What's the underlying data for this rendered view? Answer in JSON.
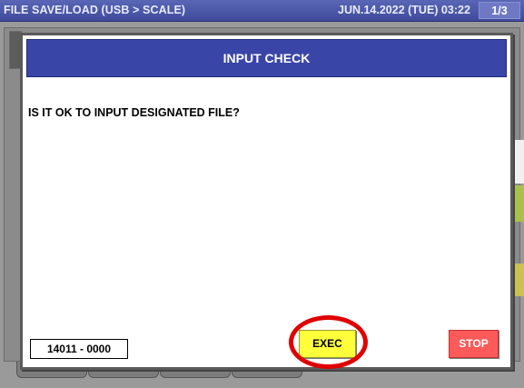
{
  "status_bar": {
    "title": "FILE SAVE/LOAD (USB > SCALE)",
    "datetime": "JUN.14.2022 (TUE)  03:22",
    "page": "1/3"
  },
  "dialog": {
    "title": "INPUT CHECK",
    "message": "IS IT OK TO INPUT DESIGNATED FILE?",
    "file_code": "14011 - 0000",
    "exec_label": "EXEC",
    "stop_label": "STOP"
  },
  "colors": {
    "status_bar": "#4a55a8",
    "dialog_header": "#3a45a8",
    "exec_button": "#ffff3c",
    "stop_button": "#ff5a5a",
    "highlight_circle": "#e00000"
  }
}
